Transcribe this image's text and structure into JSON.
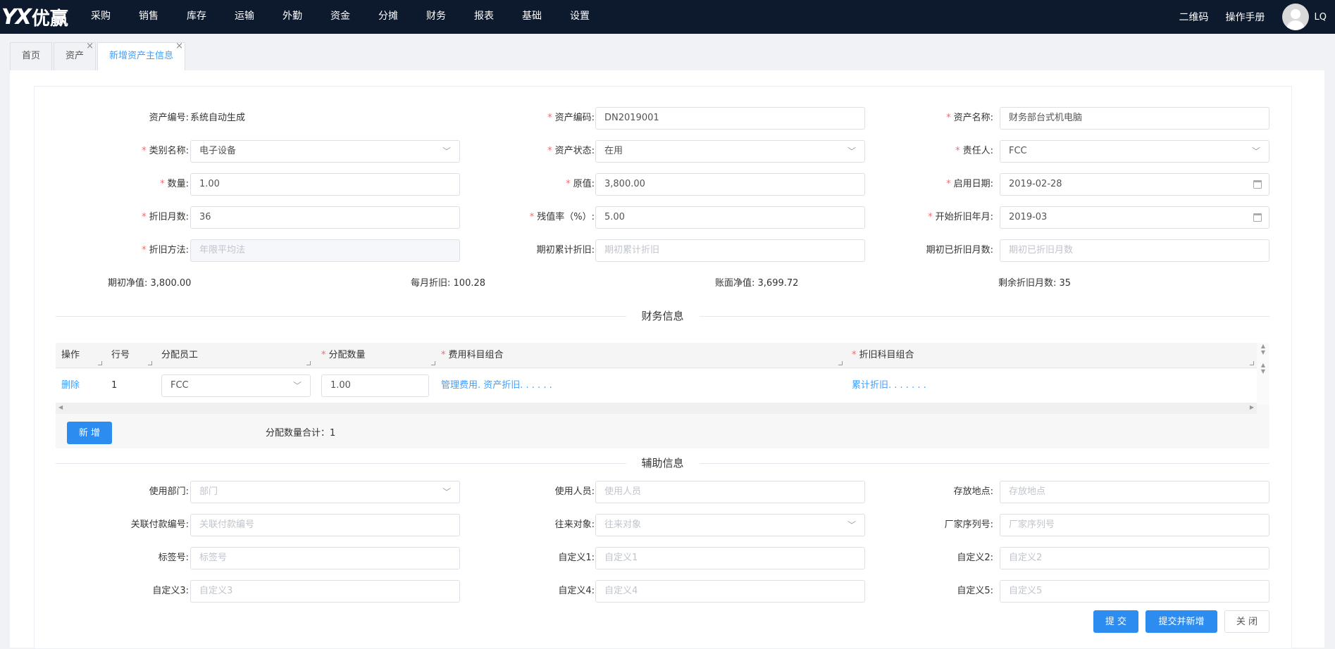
{
  "app": {
    "logo_mark": "YX",
    "logo_name": "优赢"
  },
  "menu": [
    "采购",
    "销售",
    "库存",
    "运输",
    "外勤",
    "资金",
    "分摊",
    "财务",
    "报表",
    "基础",
    "设置"
  ],
  "header": {
    "qr": "二维码",
    "manual": "操作手册",
    "user": "LQ"
  },
  "tabs": [
    {
      "label": "首页"
    },
    {
      "label": "资产",
      "close": "×"
    },
    {
      "label": "新增资产主信息",
      "close": "×"
    }
  ],
  "form": {
    "asset_no": {
      "label": "资产编号:",
      "value": "系统自动生成"
    },
    "asset_code": {
      "label": "资产编码:",
      "value": "DN2019001"
    },
    "asset_name": {
      "label": "资产名称:",
      "value": "财务部台式机电脑"
    },
    "category": {
      "label": "类别名称:",
      "value": "电子设备"
    },
    "status": {
      "label": "资产状态:",
      "value": "在用"
    },
    "owner": {
      "label": "责任人:",
      "value": "FCC"
    },
    "quantity": {
      "label": "数量:",
      "value": "1.00"
    },
    "original_value": {
      "label": "原值:",
      "value": "3,800.00"
    },
    "start_date": {
      "label": "启用日期:",
      "value": "2019-02-28"
    },
    "depr_months": {
      "label": "折旧月数:",
      "value": "36"
    },
    "residual_rate": {
      "label": "残值率（%）:",
      "value": "5.00"
    },
    "depr_start": {
      "label": "开始折旧年月:",
      "value": "2019-03"
    },
    "depr_method": {
      "label": "折旧方法:",
      "placeholder": "年限平均法"
    },
    "init_accum": {
      "label": "期初累计折旧:",
      "placeholder": "期初累计折旧"
    },
    "init_months": {
      "label": "期初已折旧月数:",
      "placeholder": "期初已折旧月数"
    },
    "summary": {
      "net_init_label": "期初净值:",
      "net_init": "3,800.00",
      "monthly_label": "每月折旧:",
      "monthly": "100.28",
      "book_label": "账面净值:",
      "book": "3,699.72",
      "remain_label": "剩余折旧月数:",
      "remain": "35"
    }
  },
  "finance_section": "财务信息",
  "grid": {
    "headers": {
      "op": "操作",
      "line": "行号",
      "employee": "分配员工",
      "qty": "分配数量",
      "expense": "费用科目组合",
      "depr": "折旧科目组合"
    },
    "rows": [
      {
        "op": "删除",
        "line": "1",
        "employee": "FCC",
        "qty": "1.00",
        "expense": "管理费用. 资产折旧. . . . . .",
        "depr": "累计折旧. . . . . . ."
      }
    ],
    "add_button": "新 增",
    "total_label": "分配数量合计：1"
  },
  "aux_section": "辅助信息",
  "aux": {
    "dept": {
      "label": "使用部门:",
      "placeholder": "部门"
    },
    "user": {
      "label": "使用人员:",
      "placeholder": "使用人员"
    },
    "location": {
      "label": "存放地点:",
      "placeholder": "存放地点"
    },
    "payment_no": {
      "label": "关联付款编号:",
      "placeholder": "关联付款编号"
    },
    "partner": {
      "label": "往来对象:",
      "placeholder": "往来对象"
    },
    "serial": {
      "label": "厂家序列号:",
      "placeholder": "厂家序列号"
    },
    "tag": {
      "label": "标签号:",
      "placeholder": "标签号"
    },
    "c1": {
      "label": "自定义1:",
      "placeholder": "自定义1"
    },
    "c2": {
      "label": "自定义2:",
      "placeholder": "自定义2"
    },
    "c3": {
      "label": "自定义3:",
      "placeholder": "自定义3"
    },
    "c4": {
      "label": "自定义4:",
      "placeholder": "自定义4"
    },
    "c5": {
      "label": "自定义5:",
      "placeholder": "自定义5"
    }
  },
  "actions": {
    "submit": "提 交",
    "submit_new": "提交并新增",
    "close": "关 闭"
  }
}
